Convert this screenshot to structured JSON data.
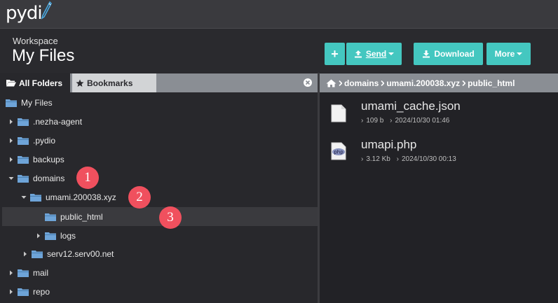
{
  "app": {
    "logo_text": "pydi"
  },
  "header": {
    "workspace_label": "Workspace",
    "title": "My Files"
  },
  "toolbar": {
    "plus_label": "+",
    "send_label": "Send",
    "download_label": "Download",
    "more_label": "More"
  },
  "tabs": {
    "all_folders": "All Folders",
    "bookmarks": "Bookmarks"
  },
  "tree": [
    {
      "label": "My Files"
    },
    {
      "label": ".nezha-agent"
    },
    {
      "label": ".pydio"
    },
    {
      "label": "backups"
    },
    {
      "label": "domains"
    },
    {
      "label": "umami.200038.xyz"
    },
    {
      "label": "public_html"
    },
    {
      "label": "logs"
    },
    {
      "label": "serv12.serv00.net"
    },
    {
      "label": "mail"
    },
    {
      "label": "repo"
    }
  ],
  "badges": [
    "1",
    "2",
    "3"
  ],
  "breadcrumb": {
    "items": [
      "domains",
      "umami.200038.xyz",
      "public_html"
    ]
  },
  "files": [
    {
      "name": "umami_cache.json",
      "size": "109 b",
      "date": "2024/10/30 01:46",
      "icon": "json-file-icon"
    },
    {
      "name": "umapi.php",
      "size": "3.12 Kb",
      "date": "2024/10/30 00:13",
      "icon": "php-file-icon"
    }
  ],
  "colors": {
    "accent": "#44c7c0",
    "badge": "#f0505e",
    "folder": "#6ea4d8"
  }
}
